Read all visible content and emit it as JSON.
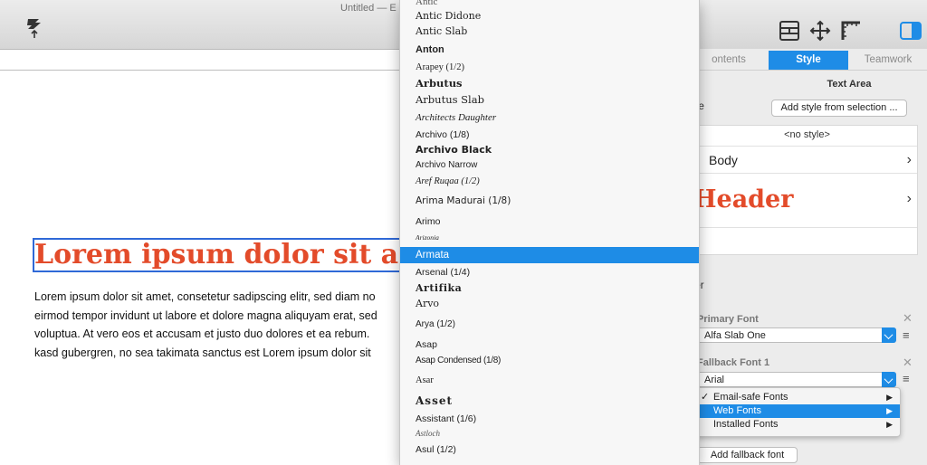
{
  "window": {
    "title": "Untitled — E"
  },
  "toolbar": {
    "icons": [
      "publish-icon",
      "layout-icon",
      "move-icon",
      "ruler-icon",
      "sidebar-toggle-icon"
    ]
  },
  "document": {
    "heading": "Lorem ipsum dolor sit am",
    "body_lines": [
      "Lorem ipsum dolor sit amet, consetetur sadipscing elitr, sed diam no",
      "eirmod tempor invidunt ut labore et dolore magna aliquyam erat, sed",
      "voluptua. At vero eos et accusam et justo duo dolores et ea rebum.",
      "kasd gubergren, no sea takimata sanctus est Lorem ipsum dolor sit"
    ]
  },
  "inspector": {
    "tabs": [
      {
        "label": "ontents",
        "active": false
      },
      {
        "label": "Style",
        "active": true
      },
      {
        "label": "Teamwork",
        "active": false
      }
    ],
    "section_title": "Text Area",
    "style_label": "le",
    "add_style_button": "Add style from selection ...",
    "styles": {
      "no_style": "<no style>",
      "body": "Body",
      "header": "Header"
    },
    "header_section_label": "der",
    "primary_font": {
      "label": "Primary Font",
      "value": "Alfa Slab One"
    },
    "fallback_font": {
      "label": "Fallback Font 1",
      "value": "Arial"
    },
    "add_fallback_button": "Add fallback font",
    "accent_color": "#1e8ce6",
    "header_color": "#e34b2a"
  },
  "font_submenu": {
    "items": [
      {
        "label": "Email-safe Fonts",
        "checked": true,
        "selected": false
      },
      {
        "label": "Web Fonts",
        "checked": false,
        "selected": true
      },
      {
        "label": "Installed Fonts",
        "checked": false,
        "selected": false
      }
    ]
  },
  "font_menu": {
    "selected": "Armata",
    "items": [
      "Antic",
      "Antic Didone",
      "Antic Slab",
      "Anton",
      "Arapey (1/2)",
      "Arbutus",
      "Arbutus Slab",
      "Architects Daughter",
      "Archivo (1/8)",
      "Archivo Black",
      "Archivo Narrow",
      "Aref Ruqaa (1/2)",
      "Arima Madurai (1/8)",
      "Arimo",
      "Arizonia",
      "Armata",
      "Arsenal (1/4)",
      "Artifika",
      "Arvo",
      "Arya (1/2)",
      "Asap",
      "Asap Condensed (1/8)",
      "Asar",
      "Asset",
      "Assistant (1/6)",
      "Astloch",
      "Asul (1/2)"
    ]
  }
}
